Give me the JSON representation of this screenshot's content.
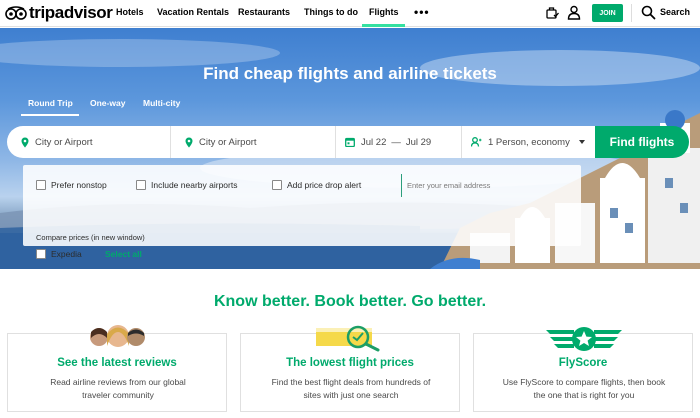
{
  "nav": {
    "logo_text": "tripadvisor",
    "items": [
      "Hotels",
      "Vacation Rentals",
      "Restaurants",
      "Things to do",
      "Flights"
    ],
    "active_item": "Flights",
    "more_icon": "more-dots-icon",
    "join_label": "JOIN",
    "search_label": "Search"
  },
  "hero": {
    "title": "Find cheap flights and airline tickets",
    "trip_types": [
      "Round Trip",
      "One-way",
      "Multi-city"
    ],
    "active_trip_type": "Round Trip",
    "from_placeholder": "City or Airport",
    "to_placeholder": "City or Airport",
    "depart_date": "Jul 22",
    "date_separator": "—",
    "return_date": "Jul 29",
    "travelers": "1 Person, economy",
    "find_button": "Find flights",
    "options": {
      "prefer_nonstop": "Prefer nonstop",
      "nearby_airports": "Include nearby airports",
      "price_drop_alert": "Add price drop alert",
      "email_placeholder": "Enter your email address",
      "compare_label": "Compare prices (in new window)",
      "expedia": "Expedia",
      "select_all": "Select all"
    }
  },
  "tagline": "Know better. Book better. Go better.",
  "cards": [
    {
      "title": "See the latest reviews",
      "text_line1": "Read airline reviews from our global",
      "text_line2": "traveler community"
    },
    {
      "title": "The lowest flight prices",
      "text_line1": "Find the best flight deals from hundreds of",
      "text_line2": "sites with just one search"
    },
    {
      "title": "FlyScore",
      "text_line1": "Use FlyScore to compare flights, then book",
      "text_line2": "the one that is right for you"
    }
  ],
  "colors": {
    "brand_green": "#00aa6c",
    "nav_underline": "#34e0a1",
    "hero_sky": "#3f7fd0"
  }
}
